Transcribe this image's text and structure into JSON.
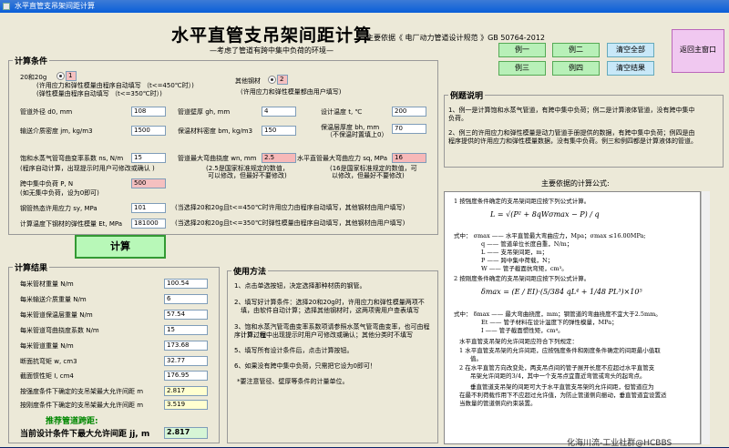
{
  "window": {
    "title": "水平直管支吊架间距计算"
  },
  "header": {
    "title": "水平直管支吊架间距计算",
    "subtitle": "—考虑了管道有跨中集中负荷的环境—",
    "basis": "主要依据《 电厂动力管道设计规范 》GB 50764-2012"
  },
  "buttons": {
    "ex1": "例一",
    "ex2": "例二",
    "ex3": "例三",
    "ex4": "例四",
    "clear_all": "清空全部",
    "clear_result": "清空结果",
    "home": "返回主窗口",
    "calc": "计算"
  },
  "conditions": {
    "legend": "计算条件",
    "radio1_label": "20和20g",
    "radio1_value": "1",
    "radio1_desc1": "(许用应力和弹性模量由程序自动填写 （t<=450℃时）)",
    "radio1_desc2": "(弹性模量由程序自动填写 （t<=350℃时）)",
    "radio2_label": "其他钢材",
    "radio2_value": "2",
    "radio2_desc": "(许用应力和弹性模量都由用户填写)",
    "fields": [
      {
        "label": "管道外径 d0, mm",
        "value": "108"
      },
      {
        "label": "管道壁厚 gh, mm",
        "value": "4"
      },
      {
        "label": "设计温度 t, ℃",
        "value": "200"
      },
      {
        "label": "输送介质密度 jm, kg/m3",
        "value": "1500"
      },
      {
        "label": "保温材料密度 bm, kg/m3",
        "value": "150"
      },
      {
        "label": "保温层厚度 bh, mm",
        "value": "70"
      },
      {
        "label": "饱和水蒸气管弯曲变率系数 ns, N/m",
        "value": "15"
      },
      {
        "label": "管道最大弯曲挠度 wn, mm",
        "value": "2.5"
      },
      {
        "label": "水平直管最大弯曲应力 sq, MPa",
        "value": "16"
      },
      {
        "label": "跨中集中负荷 P, N",
        "value": "500"
      },
      {
        "label": "钢管热态许用应力 sy, MPa",
        "value": "101"
      },
      {
        "label": "计算温度下钢材的弹性模量 Et, MPa",
        "value": "181000"
      }
    ],
    "bh_hint": "（不保温时置填上0）",
    "ns_hint": "(程序自动计算，出现提示时用户可修改或确认 )",
    "wn_hint1": "(2.5是国家标准规定的数值，",
    "wn_hint2": "可以修改，但最好不要修改)",
    "sq_hint1": "(16是国家标准规定的数值，可",
    "sq_hint2": "以修改，但最好不要修改)",
    "p_hint": "(如无集中负荷，设为0即可)",
    "sy_hint": "(当选择20和20g且t<=450℃时许用应力由程序自动填写，其他钢材由用户填写)",
    "et_hint": "(当选择20和20g且t<=350℃时弹性模量由程序自动填写，其他钢材由用户填写)"
  },
  "results": {
    "legend": "计算结果",
    "rows": [
      {
        "label": "每米管材重量 N/m",
        "value": "100.54"
      },
      {
        "label": "每米输送介质重量 N/m",
        "value": "6"
      },
      {
        "label": "每米管道保温层重量 N/m",
        "value": "57.54"
      },
      {
        "label": "每米管道弯曲挠度系数 N/m",
        "value": "15"
      },
      {
        "label": "每米管道重量 N/m",
        "value": "173.68"
      },
      {
        "label": "断面抗弯矩 w, cm3",
        "value": "32.77"
      },
      {
        "label": "截面惯性矩 I, cm4",
        "value": "176.95"
      },
      {
        "label": "按强度条件下确定的支吊架最大允许间距 m",
        "value": "2.817"
      },
      {
        "label": "按刚度条件下确定的支吊架最大允许间距 m",
        "value": "3.519"
      }
    ],
    "recommend": "推荐管道跨距:",
    "current_label": "当前设计条件下最大允许间距 jj, m",
    "current_value": "2.817"
  },
  "usage": {
    "legend": "使用方法",
    "lines": [
      "1、点击单选按钮，决定选择那种材质的钢管。",
      "2、填写好计算条件：选择20和20g时，许用应力和弹性模量两项不",
      "填，由软件自动计算；选择其他钢材时，这两项需用户查表填写",
      "3、饱和水蒸汽管弯曲变率系数项请参照水蒸气管弯曲变率，也可由程序计算，但",
      "计算过程中出现提示时用户可修改或确认；其他分类时不填写",
      "5、填写所有设计条件后，点击计算按钮。",
      "6、如果没有跨中集中负荷，只需把它设为0即可！",
      "*要注意管径、壁厚等条件的计量单位。"
    ]
  },
  "examples": {
    "legend": "例题说明",
    "lines": [
      "1、例一是计算饱和水蒸气管道，有跨中集中负荷；例二是计算液体管道，没有跨中集中",
      "负荷。",
      "2、例三的许用应力和弹性模量是动力管道手册提供的数据，有跨中集中负荷；例四是由",
      "程序提供的许用应力和弹性模量数据，没有集中负荷。例三和例四都是计算液体的管道。"
    ]
  },
  "formulas": {
    "heading": "主要依据的计算公式:",
    "lines": [
      "1 按强度条件确定的支吊架间距应按下列公式计算。",
      "式中： σmax —— 水平直管最大弯曲应力，Mpa；σmax ≤16.00MPa;",
      "q —— 管道单位长度自重，N/m；",
      "L —— 支吊架间距，m；",
      "P —— 跨中集中荷载，N；",
      "W —— 管子截面抗弯矩，cm³。",
      "2 按刚度条件确定的支吊架间距应按下列公式计算。",
      "式中： δmax —— 最大弯曲挠度，mm；钢管道的弯曲挠度不宜大于2.5mm。",
      "Et —— 管子材料在设计温度下的弹性模量，MPa；",
      "I —— 管子截面惯性矩，cm⁴。",
      "水平直管支吊架的允许间距应符合下列规定：",
      "1 水平直管支吊架的允许间距，应按强度条件和刚度条件确定的间距最小值取",
      "值。",
      "2 在水平直管方向改变处，两支吊点间的管子展开长度不应超过水平直管支",
      "吊架允许间距的3/4，其中一个支吊点宜靠近弯管或弯头的起弯点。",
      "垂直管道支吊架的间距可大于水平直管支吊架的允许间距，但管道应为",
      "在最不利荷载作用下不应超过允许值，为防止管道侧向振动，垂直管道宜设置适",
      "当数量的管道侧向约束装置。"
    ],
    "f1": "L = √(P² + 8qWσmax − P) / q",
    "f2": "δmax = (E / EI)·(5/384 qL⁴ + 1/48 PL³)×10⁵"
  },
  "watermark": "化海川流-工业社群@HCBBS"
}
